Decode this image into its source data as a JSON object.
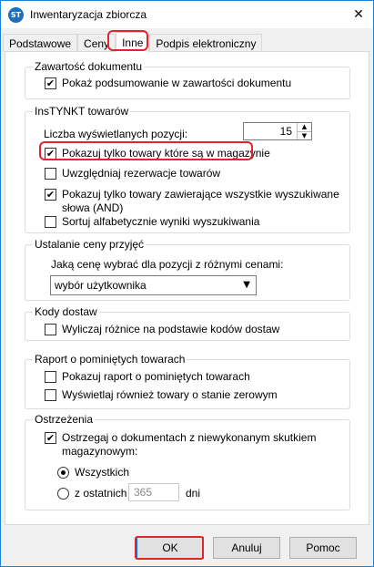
{
  "window": {
    "title": "Inwentaryzacja zbiorcza",
    "app_icon_text": "ST",
    "close_label": "✕"
  },
  "tabs": [
    {
      "label": "Podstawowe",
      "active": false
    },
    {
      "label": "Ceny",
      "active": false
    },
    {
      "label": "Inne",
      "active": true
    },
    {
      "label": "Podpis elektroniczny",
      "active": false
    }
  ],
  "groups": {
    "zawartosc": {
      "title": "Zawartość dokumentu",
      "items": [
        {
          "label": "Pokaż podsumowanie w zawartości dokumentu",
          "checked": true
        }
      ]
    },
    "instynkt": {
      "title": "InsTYNKT towarów",
      "count_label": "Liczba wyświetlanych pozycji:",
      "count_value": "15",
      "items": [
        {
          "label": "Pokazuj tylko towary które są w magazynie",
          "checked": true
        },
        {
          "label": "Uwzględniaj rezerwacje towarów",
          "checked": false
        },
        {
          "label": "Pokazuj tylko towary zawierające wszystkie wyszukiwane",
          "label2": "słowa (AND)",
          "checked": true
        },
        {
          "label": "Sortuj alfabetycznie wyniki wyszukiwania",
          "checked": false
        }
      ]
    },
    "ceny": {
      "title": "Ustalanie ceny przyjęć",
      "question": "Jaką cenę wybrać dla pozycji z różnymi cenami:",
      "selected": "wybór użytkownika"
    },
    "kody": {
      "title": "Kody dostaw",
      "items": [
        {
          "label": "Wyliczaj różnice na podstawie kodów dostaw",
          "checked": false
        }
      ]
    },
    "raport": {
      "title": "Raport o pominiętych towarach",
      "items": [
        {
          "label": "Pokazuj raport o pominiętych towarach",
          "checked": false
        },
        {
          "label": "Wyświetlaj również towary o stanie zerowym",
          "checked": false
        }
      ]
    },
    "ostrzezenia": {
      "title": "Ostrzeżenia",
      "warn_label": "Ostrzegaj o dokumentach z niewykonanym skutkiem",
      "warn_label2": "magazynowym:",
      "warn_checked": true,
      "radio_all": "Wszystkich",
      "radio_last": "z ostatnich",
      "radio_selected": "all",
      "days_value": "365",
      "days_unit": "dni"
    }
  },
  "buttons": {
    "ok": "OK",
    "cancel": "Anuluj",
    "help": "Pomoc"
  },
  "colors": {
    "highlight": "#e1252a",
    "accent": "#1883d7"
  }
}
